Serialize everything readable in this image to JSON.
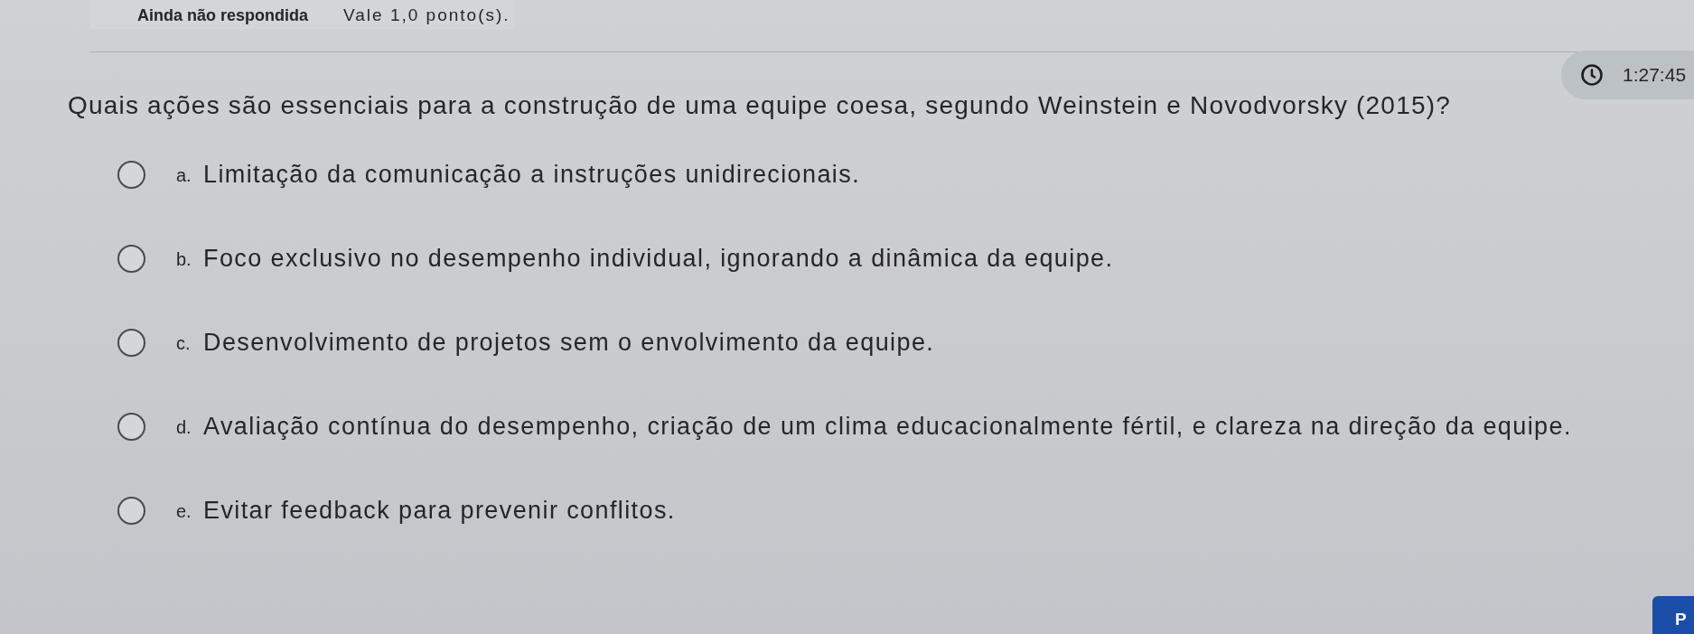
{
  "status": {
    "state": "Ainda não respondida",
    "grade": "Vale 1,0 ponto(s)."
  },
  "timer": {
    "time": "1:27:45"
  },
  "question": {
    "text": "Quais ações são essenciais para a construção de uma equipe coesa, segundo Weinstein e Novodvorsky (2015)?",
    "options": [
      {
        "letter": "a.",
        "text": "Limitação da comunicação a instruções unidirecionais.",
        "selected": false
      },
      {
        "letter": "b.",
        "text": "Foco exclusivo no desempenho individual, ignorando a dinâmica da equipe.",
        "selected": false
      },
      {
        "letter": "c.",
        "text": "Desenvolvimento de projetos sem o envolvimento da equipe.",
        "selected": false
      },
      {
        "letter": "d.",
        "text": "Avaliação contínua do desempenho, criação de um clima educacionalmente fértil, e clareza na direção da equipe.",
        "selected": false
      },
      {
        "letter": "e.",
        "text": "Evitar feedback para prevenir conflitos.",
        "selected": false
      }
    ]
  },
  "next_button": {
    "label": "P"
  }
}
